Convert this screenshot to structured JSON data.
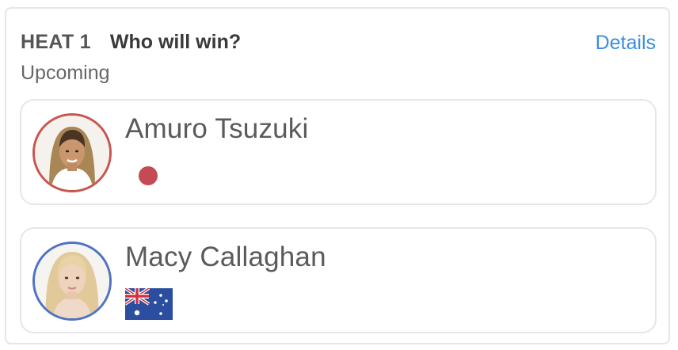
{
  "heat": {
    "label": "HEAT 1",
    "question": "Who will win?",
    "status": "Upcoming",
    "details_label": "Details"
  },
  "colors": {
    "link": "#3a8de0",
    "competitor_1_ring": "#c9554f",
    "competitor_2_ring": "#4f73c4",
    "japan_dot": "#c44a54"
  },
  "competitors": [
    {
      "name": "Amuro Tsuzuki",
      "country_icon": "japan-flag-icon"
    },
    {
      "name": "Macy Callaghan",
      "country_icon": "australia-flag-icon"
    }
  ]
}
